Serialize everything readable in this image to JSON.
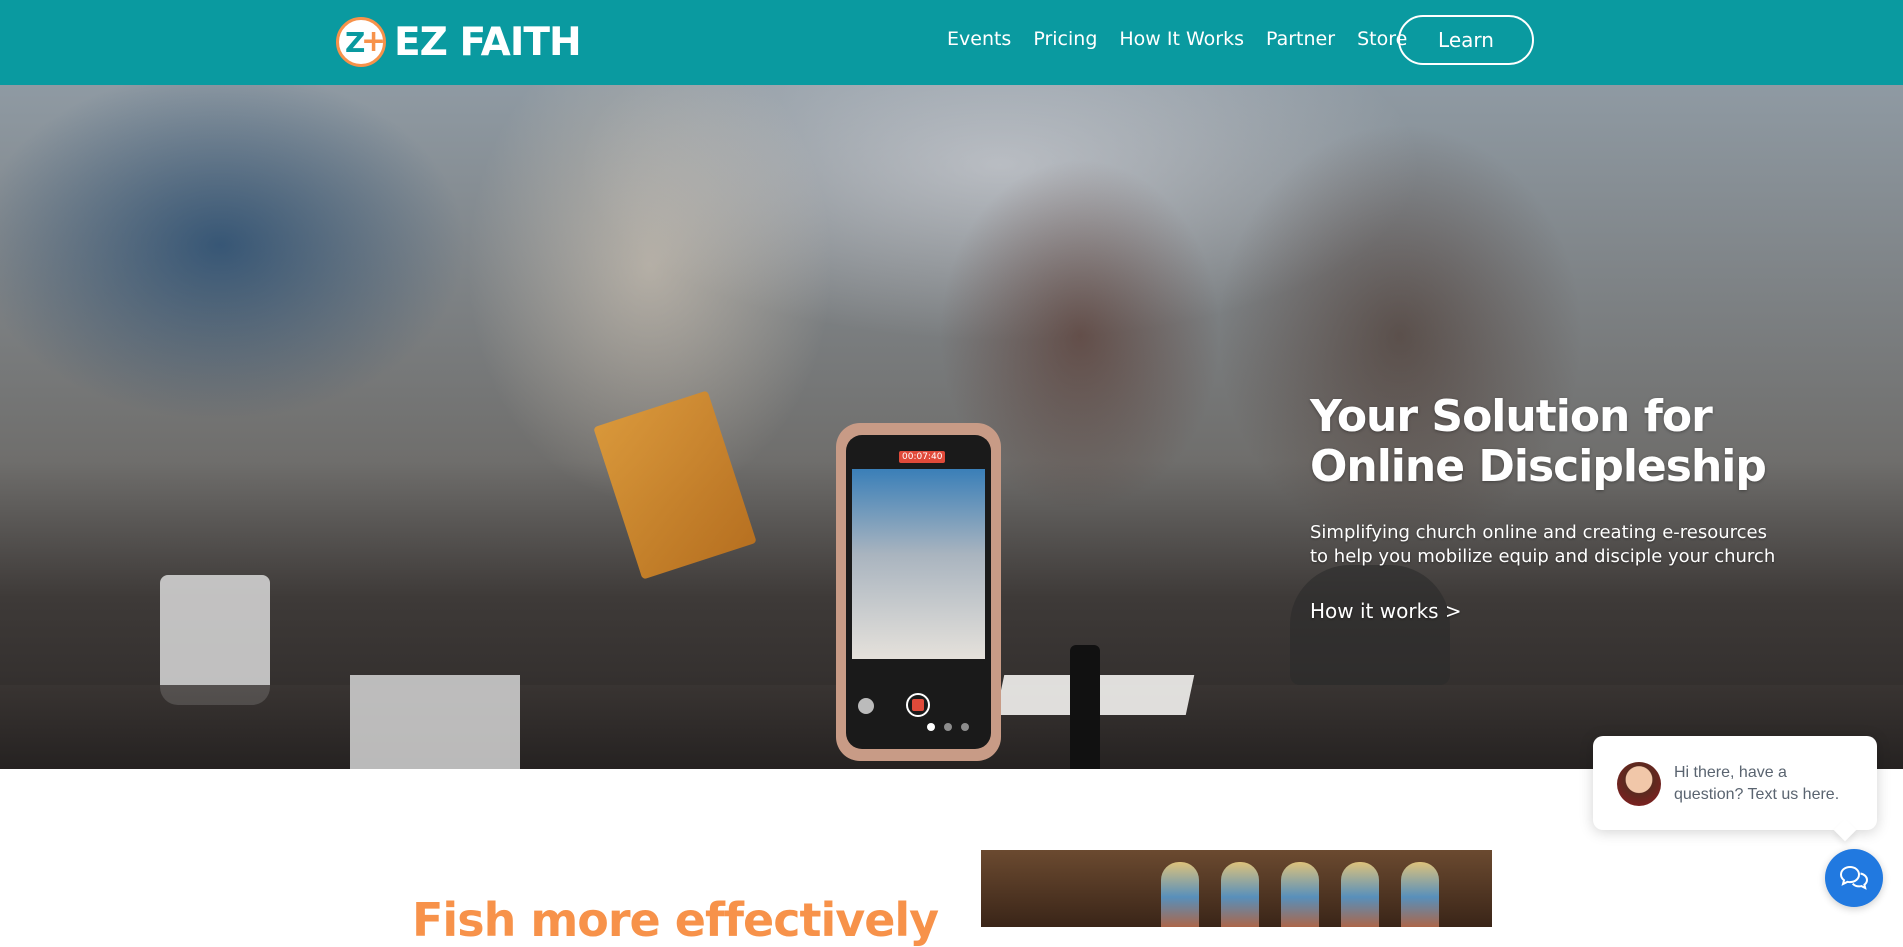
{
  "brand": {
    "name": "EZ FAITH",
    "logo_icon": "ez-faith-logo-icon"
  },
  "nav": {
    "items": [
      {
        "label": "Events"
      },
      {
        "label": "Pricing"
      },
      {
        "label": "How It Works"
      },
      {
        "label": "Partner"
      },
      {
        "label": "Store"
      }
    ],
    "cta_label": "Learn"
  },
  "hero": {
    "title_line1": "Your Solution for",
    "title_line2": "Online Discipleship",
    "subtitle_line1": "Simplifying church online and creating e-resources",
    "subtitle_line2": "to help you mobilize equip and disciple your church",
    "link_label": "How it works >",
    "phone_timer": "00:07:40",
    "carousel": {
      "count": 3,
      "active_index": 0
    }
  },
  "section": {
    "heading": "Fish more effectively"
  },
  "chat": {
    "line1": "Hi there, have a",
    "line2": "question? Text us here.",
    "launcher_icon": "chat-bubbles-icon"
  },
  "colors": {
    "header_bg": "#0a9aa0",
    "accent_orange": "#f7924a",
    "chat_blue": "#2179e0"
  }
}
